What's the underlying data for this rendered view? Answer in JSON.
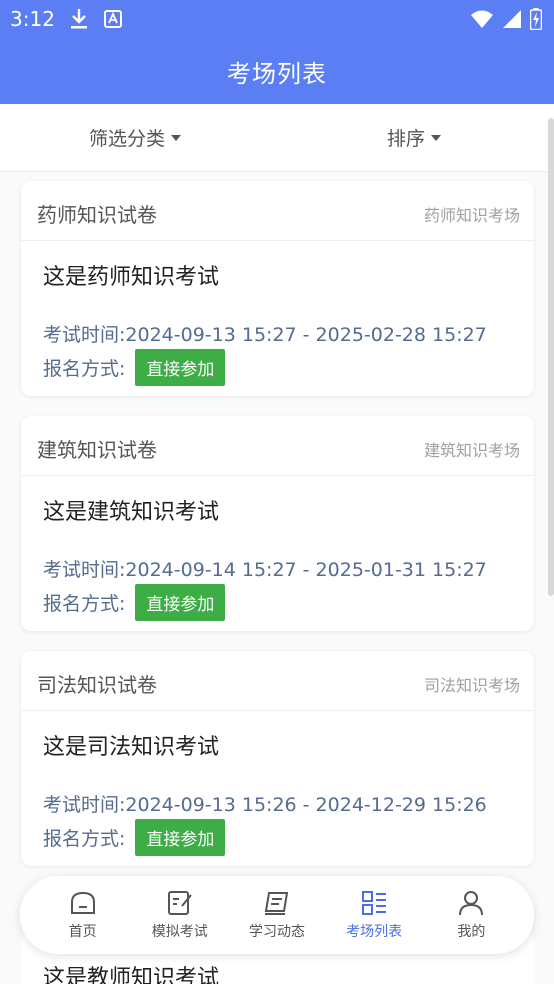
{
  "status_bar": {
    "time": "3:12"
  },
  "header": {
    "title": "考场列表"
  },
  "filters": {
    "category_label": "筛选分类",
    "sort_label": "排序"
  },
  "cards": [
    {
      "paper_title": "药师知识试卷",
      "venue": "药师知识考场",
      "exam_name": "这是药师知识考试",
      "time_label": "考试时间:",
      "time_range": "2024-09-13 15:27 - 2025-02-28 15:27",
      "signup_label": "报名方式:",
      "join_label": "直接参加"
    },
    {
      "paper_title": "建筑知识试卷",
      "venue": "建筑知识考场",
      "exam_name": "这是建筑知识考试",
      "time_label": "考试时间:",
      "time_range": "2024-09-14 15:27 - 2025-01-31 15:27",
      "signup_label": "报名方式:",
      "join_label": "直接参加"
    },
    {
      "paper_title": "司法知识试卷",
      "venue": "司法知识考场",
      "exam_name": "这是司法知识考试",
      "time_label": "考试时间:",
      "time_range": "2024-09-13 15:26 - 2024-12-29 15:26",
      "signup_label": "报名方式:",
      "join_label": "直接参加"
    }
  ],
  "partial_card": {
    "exam_name": "这是教师知识考试"
  },
  "tabs": [
    {
      "label": "首页",
      "icon": "home-icon",
      "active": false
    },
    {
      "label": "模拟考试",
      "icon": "edit-paper-icon",
      "active": false
    },
    {
      "label": "学习动态",
      "icon": "notebook-icon",
      "active": false
    },
    {
      "label": "考场列表",
      "icon": "list-grid-icon",
      "active": true
    },
    {
      "label": "我的",
      "icon": "person-icon",
      "active": false
    }
  ],
  "colors": {
    "primary": "#5b7ef5",
    "active_tab": "#4a6fe0",
    "join_button": "#3dae45",
    "meta_text": "#556b8f"
  }
}
